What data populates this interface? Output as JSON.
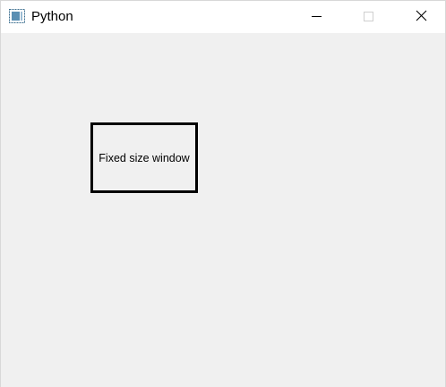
{
  "window": {
    "title": "Python",
    "app_icon": "python-app-icon",
    "controls": {
      "minimize_icon": "minimize-icon",
      "maximize_icon": "maximize-icon",
      "close_icon": "close-icon"
    }
  },
  "content": {
    "label_text": "Fixed size window"
  },
  "colors": {
    "titlebar": "#ffffff",
    "client_background": "#f0f0f0",
    "label_border": "#000000"
  }
}
